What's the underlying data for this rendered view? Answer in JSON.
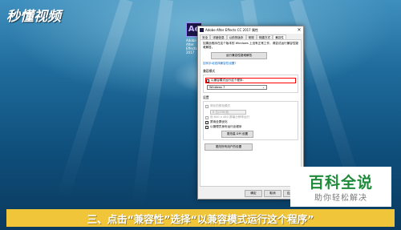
{
  "watermark": "秒懂视频",
  "desktop": {
    "icon_glyph": "Ae",
    "icon_label": "Adobe After Effects CC 2017"
  },
  "dialog": {
    "title": "Adobe After Effects CC 2017 属性",
    "close_glyph": "✕",
    "tabs": [
      "安全",
      "详细信息",
      "以前的版本",
      "常规",
      "快捷方式",
      "兼容性"
    ],
    "active_tab": "兼容性",
    "description": "如果此程序在这个版本的 Windows 上没有正常工作，请尝试运行兼容性疑难解答。",
    "troubleshoot_button": "运行兼容性疑难解答",
    "manual_link": "如何手动选择兼容性设置?",
    "compat_mode": {
      "group_title": "兼容模式",
      "checkbox_label": "以兼容模式运行这个程序:",
      "selected_os": "Windows 7",
      "chevron": "⌄"
    },
    "settings": {
      "group_title": "设置",
      "reduced_color_label": "简化的颜色模式",
      "color_depth_value": "8 位(256)色",
      "resolution_label": "用 640 x 480 屏幕分辨率运行",
      "fullscreen_label": "禁用全屏优化",
      "admin_label": "以管理员身份运行此程序",
      "dpi_button": "更改高 DPI 设置"
    },
    "all_users_button": "更改所有用户的设置",
    "ok_button": "确定",
    "cancel_button": "取消",
    "apply_button": "应用(A)"
  },
  "badge": {
    "title": "百科全说",
    "subtitle": "助你轻松解决",
    "title_color": "#1f8b3a"
  },
  "caption": {
    "text": "三、点击“兼容性”选择“以兼容模式运行这个程序”",
    "bar_color": "#f0c53a"
  }
}
